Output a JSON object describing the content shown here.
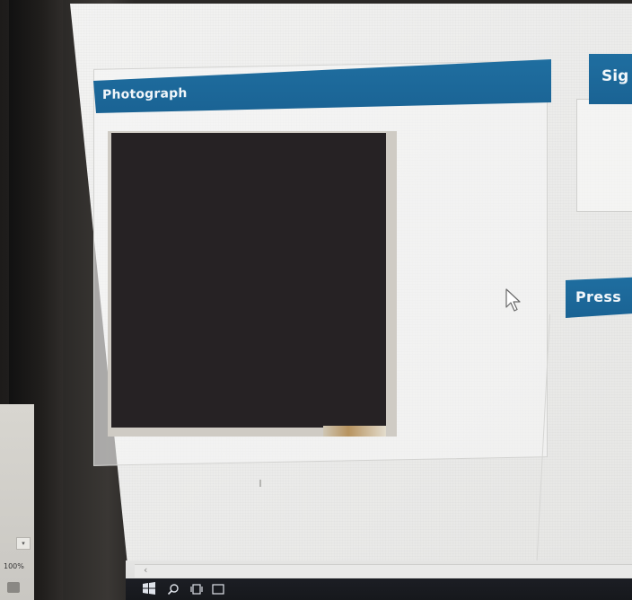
{
  "panels": {
    "photograph": {
      "title": "Photograph"
    },
    "signature": {
      "title": "Sig"
    },
    "press": {
      "title": "Press"
    }
  },
  "status": {
    "zoom": "100%"
  },
  "colors": {
    "panel_header": "#1f6ea0",
    "panel_header_text": "#f1f6fa",
    "screen_bg": "#efefee",
    "photo_fill": "#262224",
    "bezel": "#2a2826",
    "taskbar": "#1a1c20"
  },
  "icons": {
    "cursor": "arrow-pointer-icon",
    "start": "windows-start-icon",
    "search": "search-icon",
    "task_view": "task-view-icon",
    "scroll_left": "chevron-left-icon",
    "scroll_down": "chevron-down-icon"
  }
}
